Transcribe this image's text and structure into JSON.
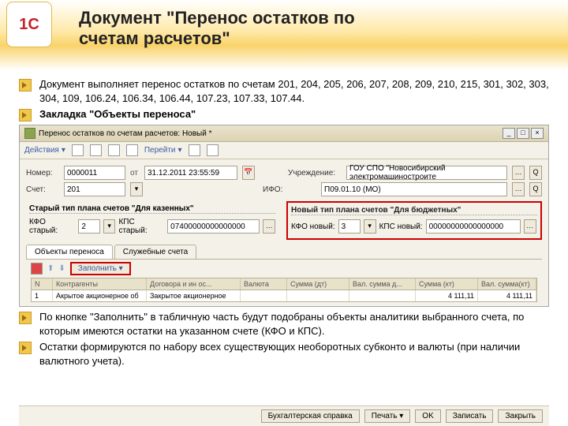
{
  "slide": {
    "logo": "1С",
    "title_l1": "Документ \"Перенос остатков по",
    "title_l2": "счетам расчетов\"",
    "bullet1": "Документ выполняет перенос остатков по счетам 201, 204, 205, 206, 207, 208, 209, 210, 215, 301, 302, 303, 304, 109, 106.24, 106.34, 106.44, 107.23, 107.33, 107.44.",
    "bullet2": "Закладка \"Объекты переноса\"",
    "bullet3": "По кнопке \"Заполнить\" в табличную часть будут подобраны объекты аналитики выбранного счета, по которым имеются остатки на указанном счете (КФО и КПС).",
    "bullet4": "Остатки формируются по набору всех существующих необоротных субконто и валюты (при наличии валютного учета)."
  },
  "app": {
    "title": "Перенос остатков по счетам расчетов: Новый *",
    "tbar": {
      "actions": "Действия",
      "goto": "Перейти"
    },
    "form": {
      "num_lbl": "Номер:",
      "num": "0000011",
      "date": "31.12.2011 23:55:59",
      "uchr_lbl": "Учреждение:",
      "uchr": "ГОУ СПО \"Новосибирский электромашиностроите",
      "schet_lbl": "Счет:",
      "schet": "201",
      "ifo_lbl": "ИФО:",
      "ifo": "П09.01.10 (МО)"
    },
    "old": {
      "title": "Старый тип плана счетов \"Для казенных\"",
      "kfo_lbl": "КФО старый:",
      "kfo": "2",
      "kps_lbl": "КПС старый:",
      "kps": "07400000000000000"
    },
    "new": {
      "title": "Новый тип плана счетов \"Для бюджетных\"",
      "kfo_lbl": "КФО новый:",
      "kfo": "3",
      "kps_lbl": "КПС новый:",
      "kps": "00000000000000000"
    },
    "tabs": {
      "t1": "Объекты переноса",
      "t2": "Служебные счета"
    },
    "fill": "Заполнить",
    "gh": {
      "n": "N",
      "ka": "Контрагенты",
      "dog": "Договора и ин ос...",
      "val": "Валюта",
      "sdt": "Сумма (дт)",
      "vsdt": "Вал. сумма д...",
      "skt": "Сумма (кт)",
      "vskt": "Вал. сумма(кт)"
    },
    "row": {
      "n": "1",
      "ka": "Акрытое акционерное об",
      "dog": "Закрытое акционерное",
      "val": "",
      "sdt": "",
      "vsdt": "",
      "skt": "4 111,11",
      "vskt": "4 111,11"
    },
    "bb": {
      "bs": "Бухгалтерская справка",
      "pr": "Печать",
      "ok": "OK",
      "zap": "Записать",
      "zak": "Закрыть"
    }
  }
}
